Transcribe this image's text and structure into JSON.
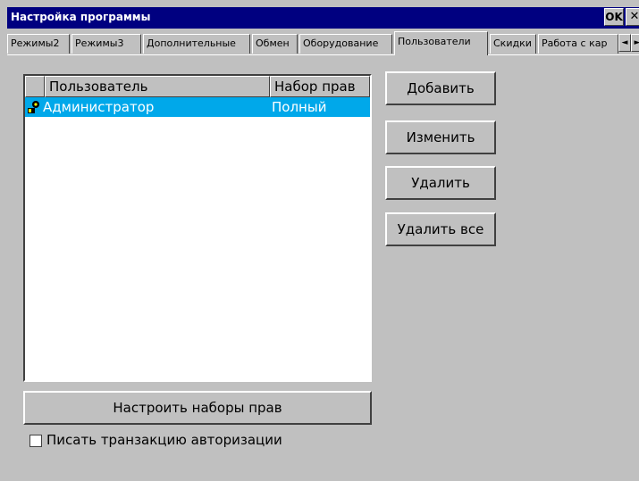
{
  "window": {
    "title": "Настройка программы",
    "ok_label": "OK",
    "close_label": "✕"
  },
  "tabs": [
    {
      "label": "Режимы2",
      "active": false
    },
    {
      "label": "Режимы3",
      "active": false
    },
    {
      "label": "Дополнительные",
      "active": false
    },
    {
      "label": "Обмен",
      "active": false
    },
    {
      "label": "Оборудование",
      "active": false
    },
    {
      "label": "Пользователи",
      "active": true
    },
    {
      "label": "Скидки",
      "active": false
    },
    {
      "label": "Работа с кар",
      "active": false
    }
  ],
  "tab_scroll": {
    "left": "◄",
    "right": "►"
  },
  "users_list": {
    "columns": [
      "",
      "Пользователь",
      "Набор прав"
    ],
    "rows": [
      {
        "icon": "user-key-icon",
        "user": "Администратор",
        "rights": "Полный",
        "selected": true
      }
    ]
  },
  "buttons": {
    "add": "Добавить",
    "edit": "Изменить",
    "delete": "Удалить",
    "delete_all": "Удалить все",
    "configure_rights": "Настроить наборы прав"
  },
  "auth_transaction": {
    "label": "Писать транзакцию авторизации",
    "checked": false
  },
  "colors": {
    "titlebar": "#000080",
    "selection": "#00a8ea",
    "face": "#c0c0c0"
  }
}
